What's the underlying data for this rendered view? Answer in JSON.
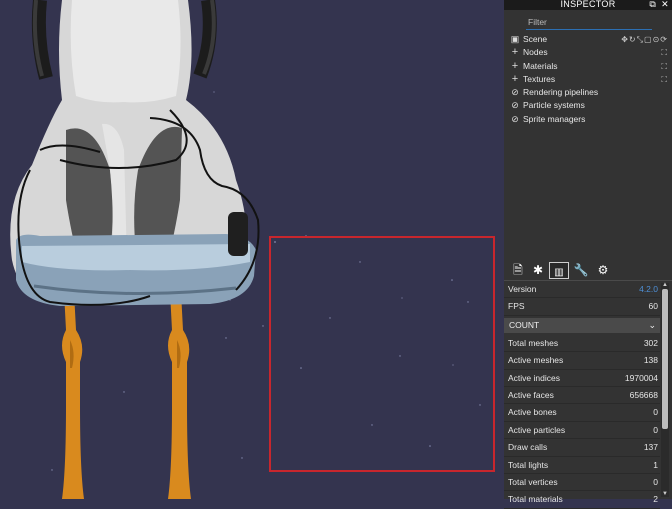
{
  "header": {
    "title": "INSPECTOR",
    "popout_icon": "popout-icon",
    "close_icon": "close-icon"
  },
  "filter": {
    "placeholder": "Filter"
  },
  "tree": {
    "scene": {
      "label": "Scene",
      "icon": "scene-icon"
    },
    "items": [
      {
        "label": "Nodes",
        "icon": "plus-icon"
      },
      {
        "label": "Materials",
        "icon": "plus-icon"
      },
      {
        "label": "Textures",
        "icon": "plus-icon"
      },
      {
        "label": "Rendering pipelines",
        "icon": "blocked-icon"
      },
      {
        "label": "Particle systems",
        "icon": "blocked-icon"
      },
      {
        "label": "Sprite managers",
        "icon": "blocked-icon"
      }
    ]
  },
  "tabs": [
    {
      "name": "properties-tab",
      "icon": "document-icon"
    },
    {
      "name": "debug-tab",
      "icon": "bug-icon"
    },
    {
      "name": "statistics-tab",
      "icon": "chart-icon",
      "active": true
    },
    {
      "name": "tools-tab",
      "icon": "wrench-icon"
    },
    {
      "name": "settings-tab",
      "icon": "gear-icon"
    }
  ],
  "stats": {
    "version_label": "Version",
    "version_value": "4.2.0",
    "fps_label": "FPS",
    "fps_value": "60",
    "count_header": "COUNT",
    "rows": [
      {
        "label": "Total meshes",
        "value": "302"
      },
      {
        "label": "Active meshes",
        "value": "138"
      },
      {
        "label": "Active indices",
        "value": "1970004"
      },
      {
        "label": "Active faces",
        "value": "656668"
      },
      {
        "label": "Active bones",
        "value": "0"
      },
      {
        "label": "Active particles",
        "value": "0"
      },
      {
        "label": "Draw calls",
        "value": "137"
      },
      {
        "label": "Total lights",
        "value": "1"
      },
      {
        "label": "Total vertices",
        "value": "0"
      },
      {
        "label": "Total materials",
        "value": "2"
      }
    ]
  },
  "colors": {
    "viewport_bg": "#34344f",
    "selection_box": "#c8262d",
    "inspector_bg": "#333333",
    "version_blue": "#4e8fd6"
  }
}
